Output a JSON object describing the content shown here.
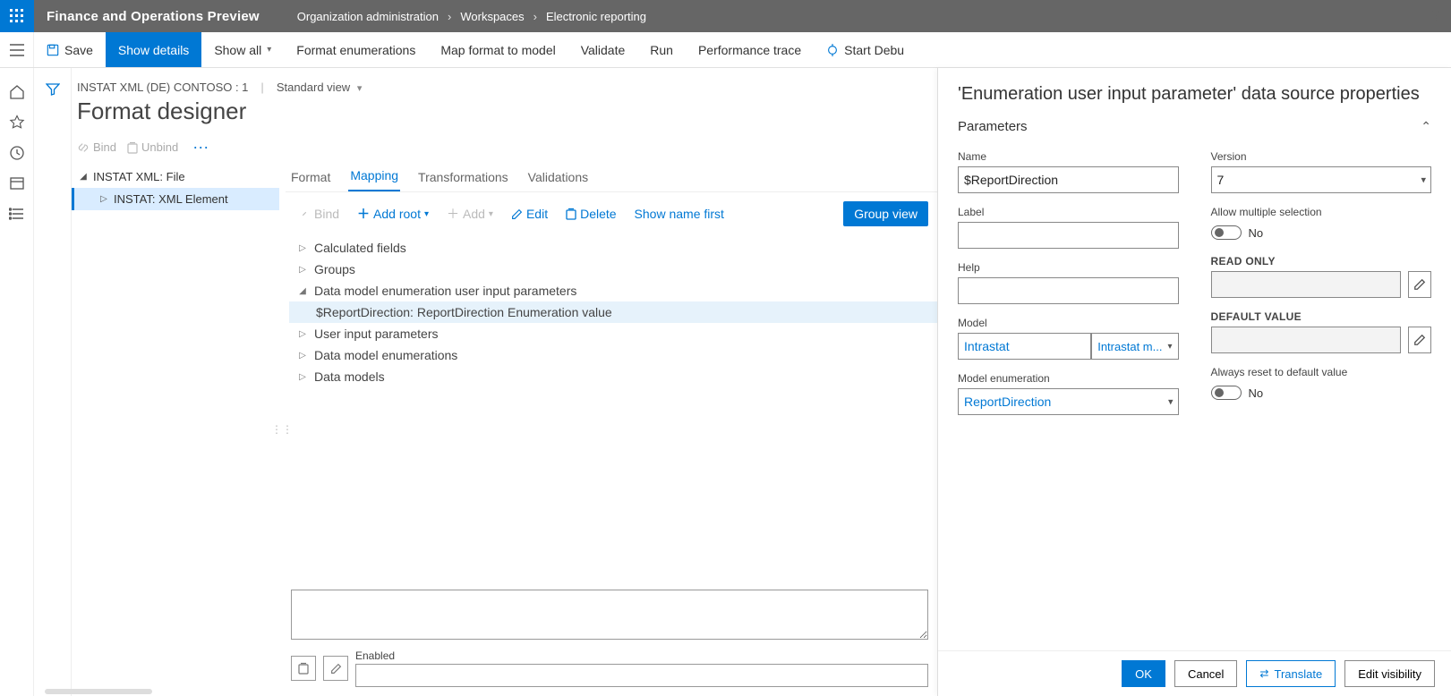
{
  "appbar": {
    "title": "Finance and Operations Preview",
    "breadcrumbs": [
      "Organization administration",
      "Workspaces",
      "Electronic reporting"
    ]
  },
  "cmdbar": {
    "save": "Save",
    "show_details": "Show details",
    "show_all": "Show all",
    "format_enums": "Format enumerations",
    "map_format": "Map format to model",
    "validate": "Validate",
    "run": "Run",
    "perf": "Performance trace",
    "start_debug": "Start Debu"
  },
  "page": {
    "record": "INSTAT XML (DE) CONTOSO : 1",
    "view": "Standard view",
    "title": "Format designer",
    "bind": "Bind",
    "unbind": "Unbind"
  },
  "leftTree": {
    "root": "INSTAT XML: File",
    "child": "INSTAT: XML Element"
  },
  "tabs": {
    "format": "Format",
    "mapping": "Mapping",
    "transformations": "Transformations",
    "validations": "Validations"
  },
  "mapbar": {
    "bind": "Bind",
    "add_root": "Add root",
    "add": "Add",
    "edit": "Edit",
    "delete": "Delete",
    "show_name_first": "Show name first",
    "group_view": "Group view"
  },
  "mapTree": {
    "n0": "Calculated fields",
    "n1": "Groups",
    "n2": "Data model enumeration user input parameters",
    "n2c": "$ReportDirection: ReportDirection Enumeration value",
    "n3": "User input parameters",
    "n4": "Data model enumerations",
    "n5": "Data models"
  },
  "bottom": {
    "enabled": "Enabled"
  },
  "flyout": {
    "title": "'Enumeration user input parameter' data source properties",
    "section": "Parameters",
    "fields": {
      "name_label": "Name",
      "name_value": "$ReportDirection",
      "label_label": "Label",
      "label_value": "",
      "help_label": "Help",
      "help_value": "",
      "model_label": "Model",
      "model_value": "Intrastat",
      "model_more": "Intrastat m...",
      "model_enum_label": "Model enumeration",
      "model_enum_value": "ReportDirection",
      "version_label": "Version",
      "version_value": "7",
      "allow_multi_label": "Allow multiple selection",
      "allow_multi_value": "No",
      "readonly_label": "READ ONLY",
      "default_label": "DEFAULT VALUE",
      "reset_label": "Always reset to default value",
      "reset_value": "No"
    },
    "footer": {
      "ok": "OK",
      "cancel": "Cancel",
      "translate": "Translate",
      "edit_vis": "Edit visibility"
    }
  }
}
